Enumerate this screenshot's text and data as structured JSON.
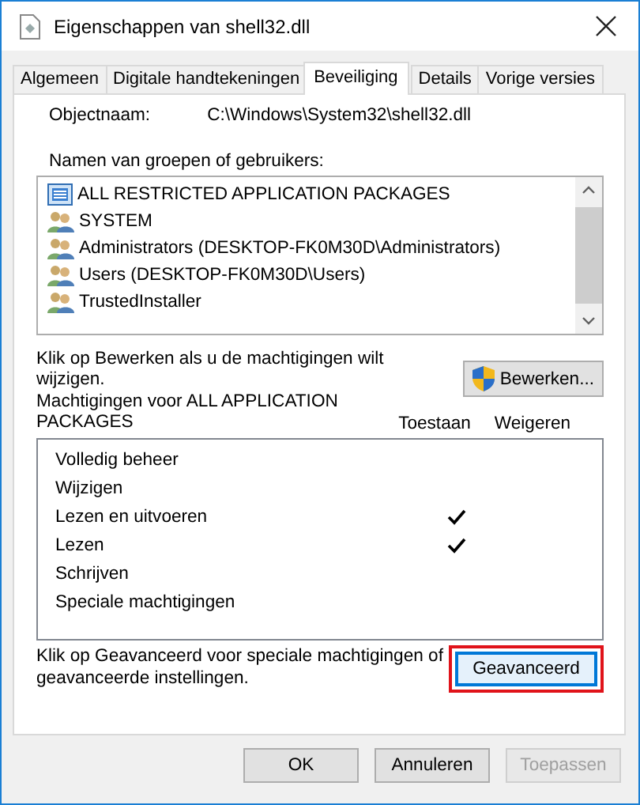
{
  "window": {
    "title": "Eigenschappen van shell32.dll"
  },
  "tabs": [
    {
      "label": "Algemeen",
      "selected": false
    },
    {
      "label": "Digitale handtekeningen",
      "selected": false
    },
    {
      "label": "Beveiliging",
      "selected": true
    },
    {
      "label": "Details",
      "selected": false
    },
    {
      "label": "Vorige versies",
      "selected": false
    }
  ],
  "object_name": {
    "label": "Objectnaam:",
    "value": "C:\\Windows\\System32\\shell32.dll"
  },
  "groups": {
    "label": "Namen van groepen of gebruikers:",
    "items": [
      {
        "name": "ALL RESTRICTED APPLICATION PACKAGES",
        "kind": "package"
      },
      {
        "name": "SYSTEM",
        "kind": "group"
      },
      {
        "name": "Administrators (DESKTOP-FK0M30D\\Administrators)",
        "kind": "group"
      },
      {
        "name": "Users (DESKTOP-FK0M30D\\Users)",
        "kind": "group"
      },
      {
        "name": "TrustedInstaller",
        "kind": "group"
      }
    ]
  },
  "edit_hint": "Klik op Bewerken als u de machtigingen wilt wijzigen.",
  "edit_button": "Bewerken...",
  "permissions": {
    "title": "Machtigingen voor ALL APPLICATION PACKAGES",
    "columns": [
      "Toestaan",
      "Weigeren"
    ],
    "rows": [
      {
        "name": "Volledig beheer",
        "allow": false,
        "deny": false
      },
      {
        "name": "Wijzigen",
        "allow": false,
        "deny": false
      },
      {
        "name": "Lezen en uitvoeren",
        "allow": true,
        "deny": false
      },
      {
        "name": "Lezen",
        "allow": true,
        "deny": false
      },
      {
        "name": "Schrijven",
        "allow": false,
        "deny": false
      },
      {
        "name": "Speciale machtigingen",
        "allow": false,
        "deny": false
      }
    ]
  },
  "advanced_hint": "Klik op Geavanceerd voor speciale machtigingen of geavanceerde instellingen.",
  "advanced_button": {
    "label": "Geavanceerd",
    "highlighted": true
  },
  "buttons": [
    {
      "label": "OK",
      "disabled": false
    },
    {
      "label": "Annuleren",
      "disabled": false
    },
    {
      "label": "Toepassen",
      "disabled": true
    }
  ]
}
